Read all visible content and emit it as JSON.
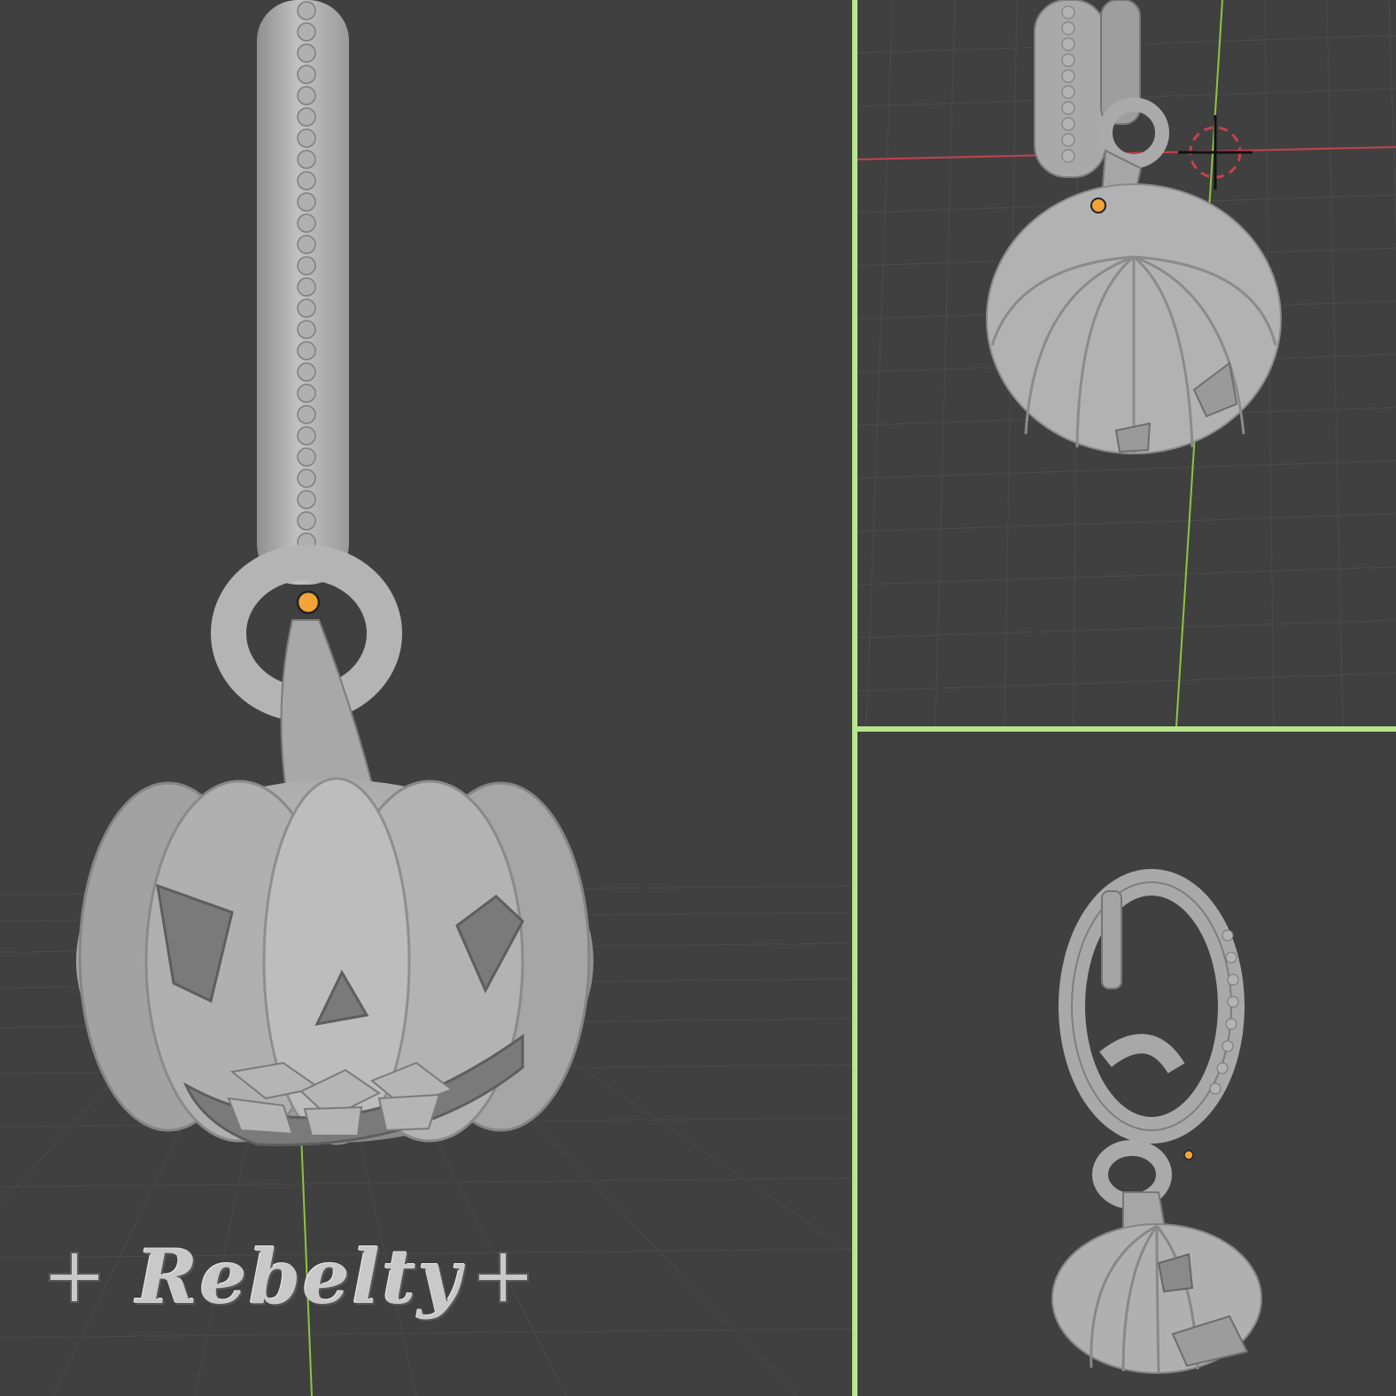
{
  "layout": "three-viewport-3d-modeling-view",
  "colors": {
    "background": "#404040",
    "grid_line": "#4a4a4a",
    "model": "#b8b8b8",
    "model_shadow": "#8c8c8c",
    "divider": "#b8e58c",
    "origin_point": "#f2a33a",
    "axis_x": "#c6414e",
    "axis_y": "#8cc63f",
    "watermark": "#c9c9c9"
  },
  "viewports": {
    "main": {
      "subject": "pumpkin-hoop-earring-front-closeup",
      "origin_marker": "orange-dot"
    },
    "top_right": {
      "subject": "pumpkin-charm-top-view",
      "origin_marker": "orange-dot",
      "cursor": "3d-cursor-icon"
    },
    "bottom_right": {
      "subject": "pumpkin-hoop-earring-side-view",
      "origin_marker": "orange-dot"
    }
  },
  "watermark": {
    "text": "Rebelty",
    "ornament": "cross-icon"
  }
}
